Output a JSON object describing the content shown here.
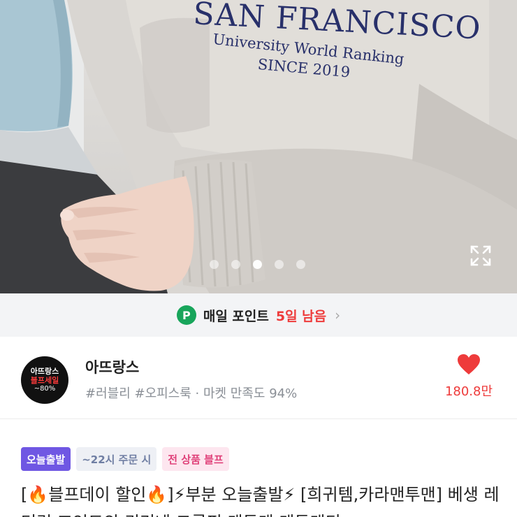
{
  "hero": {
    "sweatshirt_print": {
      "title": "SAN FRANCISCO",
      "subtitle": "University World Ranking",
      "since": "SINCE 2019"
    },
    "carousel": {
      "count": 5,
      "active_index": 2
    },
    "expand_icon": "expand-icon"
  },
  "points": {
    "icon_letter": "P",
    "label": "매일 포인트",
    "remaining": "5일 남음",
    "chevron": "›"
  },
  "shop": {
    "logo": {
      "line1": "아뜨랑스",
      "line2": "블프세일",
      "line3": "~80%"
    },
    "name": "아뜨랑스",
    "tags": "#러블리 #오피스룩 · 마켓 만족도 94%",
    "likes": "180.8만",
    "heart_icon": "heart-icon"
  },
  "badges": [
    "오늘출발",
    "~22시 주문 시",
    "전 상품 블프"
  ],
  "product": {
    "title": "[🔥블프데이 할인🔥]⚡부분 오늘출발⚡ [희귀템,카라맨투맨] 베생 레터링 포인트의 귀리네 크롭핏 맨투맨 맨투맨티"
  },
  "colors": {
    "accent_red": "#ee3b3b",
    "points_green": "#18a55b",
    "badge_purple": "#6f57e3",
    "badge_pink_text": "#e0427a",
    "print_navy": "#28306a"
  }
}
